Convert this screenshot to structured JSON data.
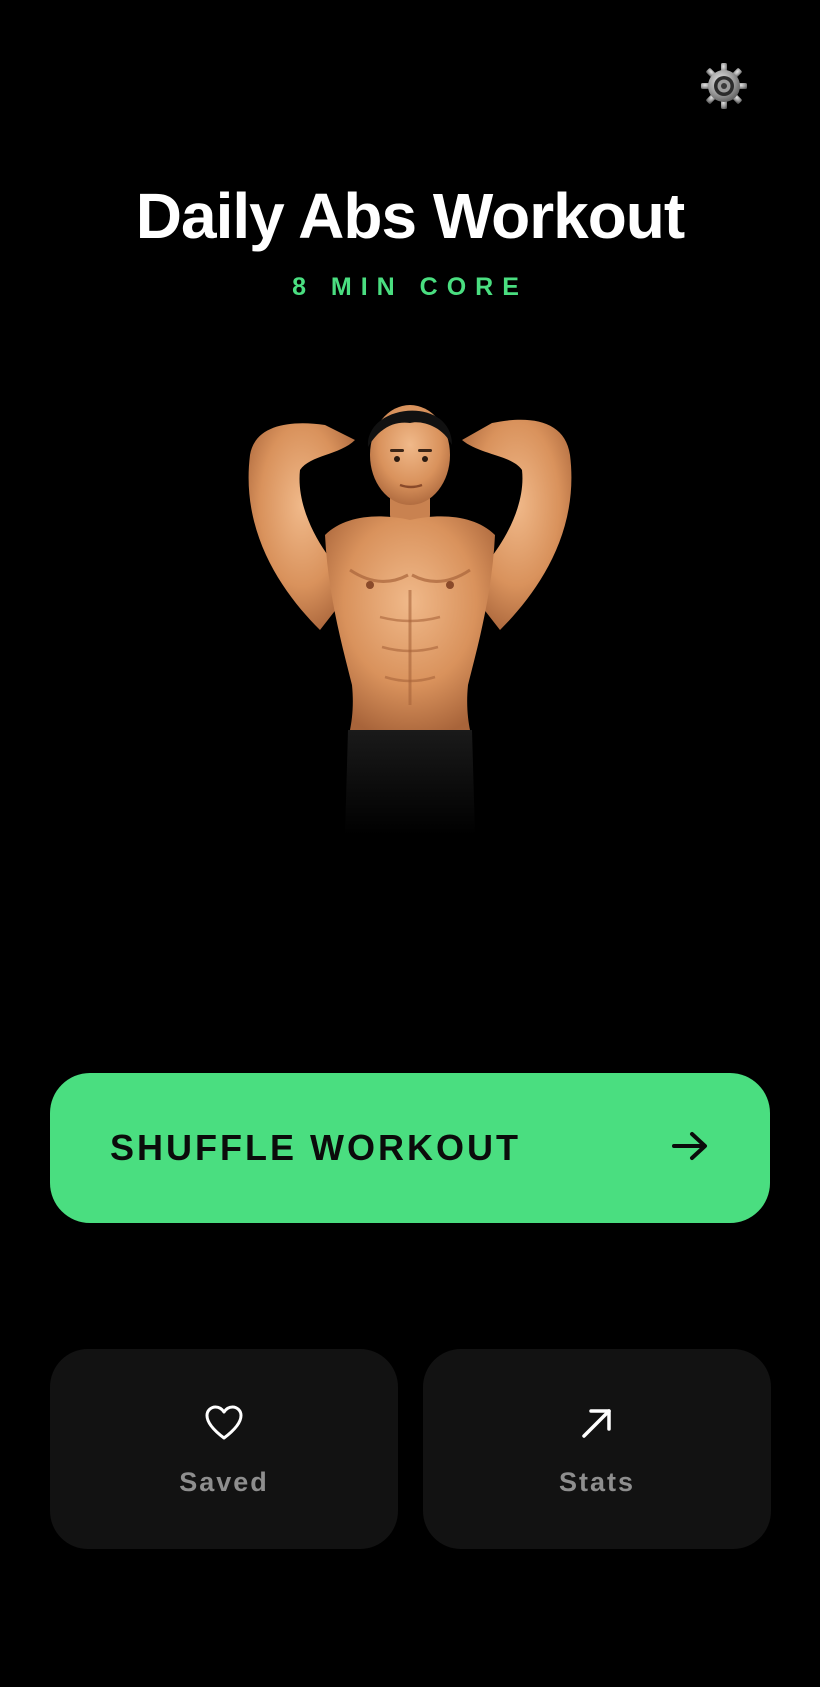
{
  "app": {
    "title": "Daily Abs Workout",
    "subtitle": "8 MIN CORE"
  },
  "header": {
    "settings_icon": "gear-icon"
  },
  "hero": {
    "image": "shirtless-man-abs-photo"
  },
  "actions": {
    "shuffle_label": "SHUFFLE WORKOUT",
    "shuffle_icon": "arrow-right-icon"
  },
  "cards": {
    "saved_label": "Saved",
    "saved_icon": "heart-icon",
    "stats_label": "Stats",
    "stats_icon": "arrow-up-right-icon"
  },
  "colors": {
    "background": "#000000",
    "accent": "#4ade80",
    "card": "#121212",
    "muted_text": "#8e8e8e"
  }
}
